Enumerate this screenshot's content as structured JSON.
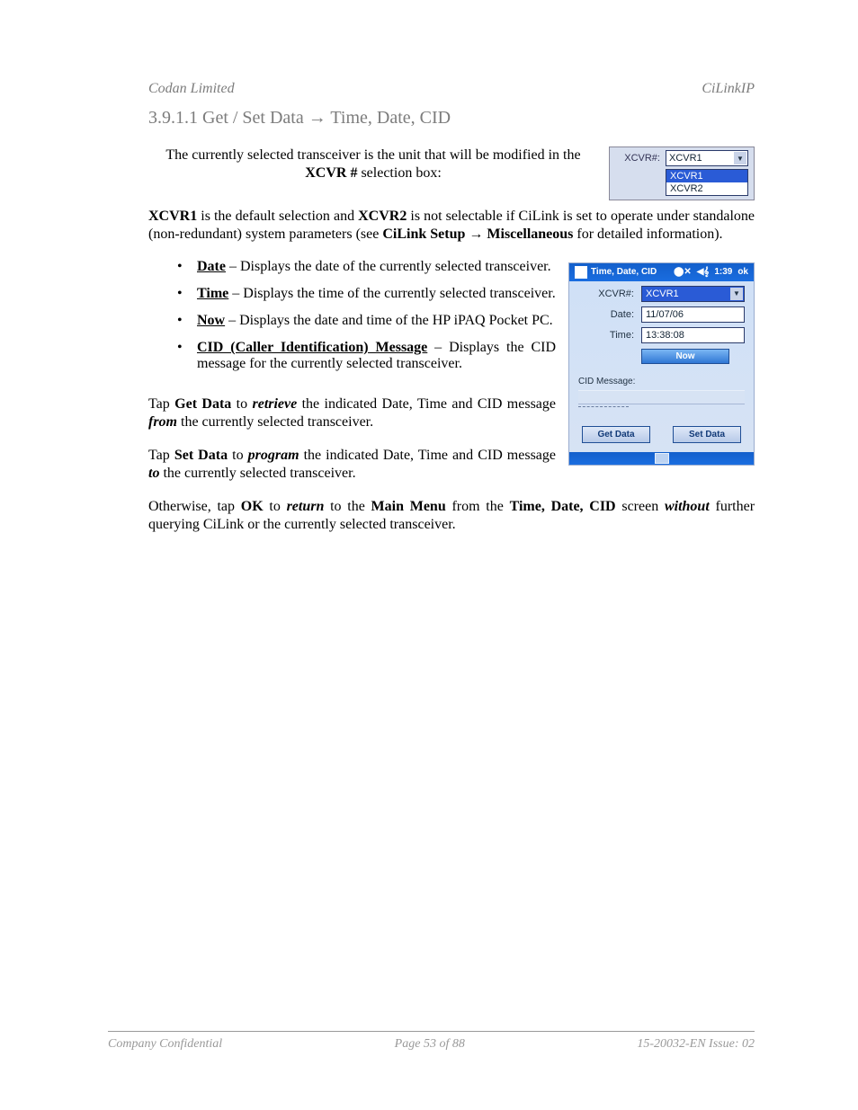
{
  "header": {
    "company": "Codan Limited",
    "product": "CiLinkIP"
  },
  "section": {
    "prefix": "3.9.1.1   Get / Set Data ",
    "arrow": "→",
    "suffix": " Time, Date, CID"
  },
  "intro": {
    "line1_a": "The currently selected transceiver is the unit that will be modified in the",
    "line1_b": "XCVR #",
    "line1_c": " selection box:"
  },
  "xcvr_small": {
    "label": "XCVR#:",
    "value": "XCVR1",
    "options": [
      "XCVR1",
      "XCVR2"
    ]
  },
  "para2": {
    "p1a": "XCVR1",
    "p1b": " is the default selection and ",
    "p1c": "XCVR2",
    "p1d": " is not selectable if CiLink is set to operate under standalone (non-redundant) system parameters (see ",
    "p1e": "CiLink Setup ",
    "p1arrow": "→",
    "p1f": " Miscellaneous",
    "p1g": " for detailed information)."
  },
  "bullets": [
    {
      "u": "Date",
      "rest": " – Displays the date of the currently selected transceiver."
    },
    {
      "u": "Time",
      "rest": " – Displays the time of the currently selected transceiver."
    },
    {
      "u": "Now",
      "rest": " – Displays the date and time of the HP iPAQ Pocket PC."
    },
    {
      "u": "CID (Caller Identification) Message",
      "rest": " – Displays the CID message for the currently selected transceiver."
    }
  ],
  "para3": {
    "a": "Tap ",
    "b": "Get Data",
    "c": " to ",
    "d": "retrieve",
    "e": " the indicated Date, Time and CID message ",
    "f": "from",
    "g": " the currently selected transceiver."
  },
  "para4": {
    "a": "Tap ",
    "b": "Set Data",
    "c": " to ",
    "d": "program",
    "e": " the indicated Date, Time and CID message ",
    "f": "to",
    "g": " the currently selected transceiver."
  },
  "para5": {
    "a": "Otherwise, tap ",
    "b": "OK",
    "c": " to ",
    "d": "return",
    "e": " to the ",
    "f": "Main Menu",
    "g": " from the ",
    "h": "Time, Date, CID",
    "i": " screen ",
    "j": "without",
    "k": " further querying CiLink or the currently selected transceiver."
  },
  "pda": {
    "title": "Time, Date, CID",
    "clock": "1:39",
    "ok": "ok",
    "xcvr_label": "XCVR#:",
    "xcvr_value": "XCVR1",
    "date_label": "Date:",
    "date_value": "11/07/06",
    "time_label": "Time:",
    "time_value": "13:38:08",
    "now": "Now",
    "cid_label": "CID Message:",
    "get": "Get Data",
    "set": "Set Data"
  },
  "footer": {
    "confidential": "Company Confidential",
    "page": "Page 53 of 88",
    "doc": "15-20032-EN Issue: 02"
  }
}
